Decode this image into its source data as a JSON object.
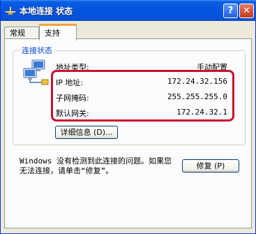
{
  "window": {
    "title": "本地连接 状态",
    "help_label": "?",
    "close_label": "✕"
  },
  "tabs": [
    {
      "label": "常规",
      "active": false
    },
    {
      "label": "支持",
      "active": true
    }
  ],
  "connection_status": {
    "group_title": "连接状态",
    "address_type_label": "地址类型:",
    "address_type_value": "手动配置",
    "ip_label": "IP 地址:",
    "ip_value": "172.24.32.156",
    "subnet_label": "子网掩码:",
    "subnet_value": "255.255.255.0",
    "gateway_label": "默认网关:",
    "gateway_value": "172.24.32.1",
    "details_button": "详细信息 (D)..."
  },
  "message": "Windows 没有检测到此连接的问题。如果您无法连接，请单击“修复”。",
  "repair_button": "修复 (P)",
  "colors": {
    "highlight_border": "#C8102E",
    "group_title": "#0046D5",
    "titlebar": "#0A5FE4"
  }
}
